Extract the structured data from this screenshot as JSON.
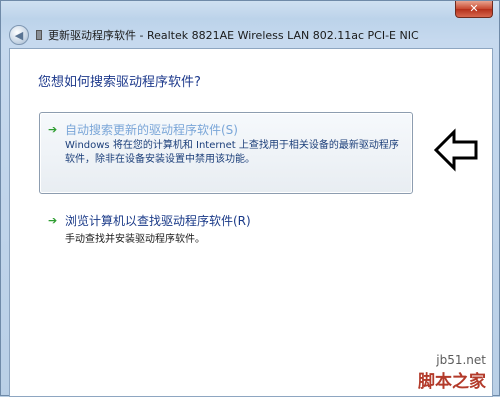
{
  "window": {
    "title": "更新驱动程序软件 - Realtek 8821AE Wireless LAN 802.11ac PCI-E NIC",
    "close_glyph": "✕"
  },
  "dialog": {
    "question": "您想如何搜索驱动程序软件?",
    "options": [
      {
        "title": "自动搜索更新的驱动程序软件(S)",
        "description": "Windows 将在您的计算机和 Internet 上查找用于相关设备的最新驱动程序软件，除非在设备安装设置中禁用该功能。",
        "arrow_icon": "green-arrow-icon",
        "highlighted": true
      },
      {
        "title": "浏览计算机以查找驱动程序软件(R)",
        "description": "手动查找并安装驱动程序软件。",
        "arrow_icon": "green-arrow-icon",
        "highlighted": false
      }
    ]
  },
  "watermark": {
    "site": "jb51.net",
    "name": "脚本之家"
  },
  "colors": {
    "accent": "#1e3a8c",
    "arrow_green": "#2e9d31",
    "close_red": "#c7472e"
  }
}
